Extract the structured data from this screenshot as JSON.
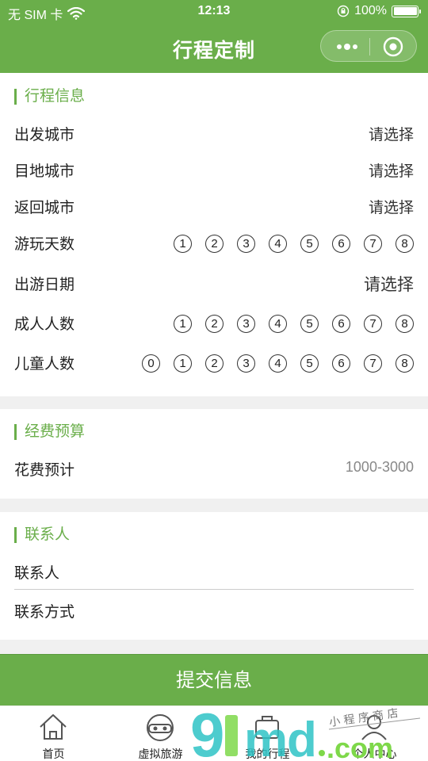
{
  "status_bar": {
    "carrier": "无 SIM 卡",
    "time": "12:13",
    "battery": "100%",
    "icons": [
      "wifi-icon",
      "orientation-lock-icon",
      "battery-icon"
    ]
  },
  "nav": {
    "title": "行程定制",
    "capsule_icons": [
      "more-icon",
      "close-icon"
    ]
  },
  "trip_info": {
    "section_title": "行程信息",
    "departure_city": {
      "label": "出发城市",
      "value": "请选择"
    },
    "destination_city": {
      "label": "目地城市",
      "value": "请选择"
    },
    "return_city": {
      "label": "返回城市",
      "value": "请选择"
    },
    "days": {
      "label": "游玩天数",
      "options": [
        "1",
        "2",
        "3",
        "4",
        "5",
        "6",
        "7",
        "8"
      ]
    },
    "date": {
      "label": "出游日期",
      "value": "请选择"
    },
    "adults": {
      "label": "成人人数",
      "options": [
        "1",
        "2",
        "3",
        "4",
        "5",
        "6",
        "7",
        "8"
      ]
    },
    "children": {
      "label": "儿童人数",
      "options": [
        "0",
        "1",
        "2",
        "3",
        "4",
        "5",
        "6",
        "7",
        "8"
      ]
    }
  },
  "budget": {
    "section_title": "经费预算",
    "cost": {
      "label": "花费预计",
      "value": "1000-3000"
    }
  },
  "contact": {
    "section_title": "联系人",
    "name_label": "联系人",
    "method_label": "联系方式"
  },
  "submit_label": "提交信息",
  "tabbar": {
    "items": [
      {
        "label": "首页",
        "icon": "home-icon"
      },
      {
        "label": "虚拟旅游",
        "icon": "vr-headset-icon"
      },
      {
        "label": "我的行程",
        "icon": "suitcase-icon"
      },
      {
        "label": "个人中心",
        "icon": "user-icon"
      }
    ]
  },
  "watermark": {
    "text": "91md.com",
    "tagline": "小程序商店"
  },
  "colors": {
    "accent": "#6aae4a",
    "background": "#f0f0f0",
    "watermark_cyan": "#2ec4c6",
    "watermark_green": "#7ed84a"
  }
}
